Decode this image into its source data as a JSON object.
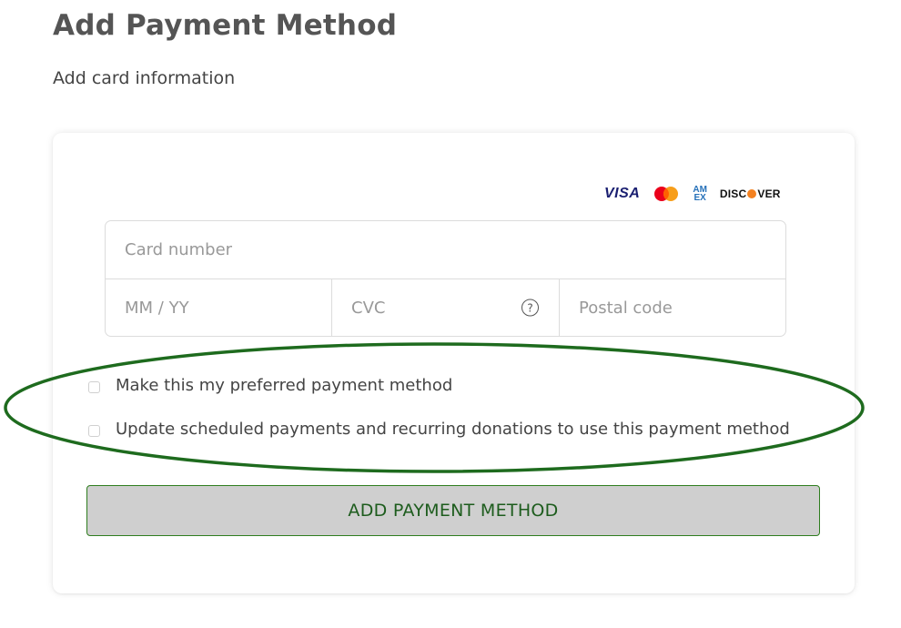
{
  "page": {
    "title": "Add Payment Method",
    "subtitle": "Add card information"
  },
  "card_brands": {
    "visa": "VISA",
    "mastercard_icon": "mastercard-icon",
    "amex_line1": "AM",
    "amex_line2": "EX",
    "discover_prefix": "DISC",
    "discover_suffix": "VER"
  },
  "form": {
    "card_number_placeholder": "Card number",
    "expiry_placeholder": "MM / YY",
    "cvc_placeholder": "CVC",
    "cvc_help_icon": "help-circle-icon",
    "cvc_help_glyph": "?",
    "postal_placeholder": "Postal code"
  },
  "options": {
    "preferred_label": "Make this my preferred payment method",
    "preferred_checked": false,
    "update_scheduled_label": "Update scheduled payments and recurring donations to use this payment method",
    "update_scheduled_checked": false
  },
  "actions": {
    "submit_label": "ADD PAYMENT METHOD"
  },
  "colors": {
    "highlight_ellipse": "#1e6b1e",
    "button_border": "#2e7d1e",
    "button_text": "#1d5c1d",
    "button_bg": "#cfcfcf"
  }
}
